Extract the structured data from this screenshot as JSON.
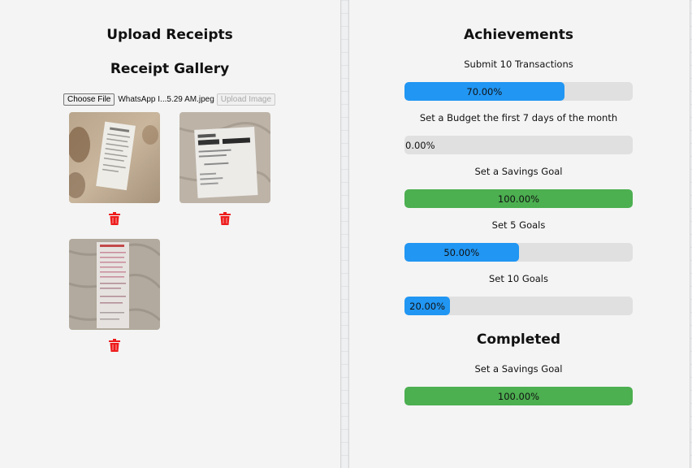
{
  "upload": {
    "title": "Upload Receipts",
    "gallery_title": "Receipt Gallery",
    "choose_file_label": "Choose File",
    "file_name": "WhatsApp I...5.29 AM.jpeg",
    "upload_button_label": "Upload Image",
    "receipts": [
      {
        "icon": "trash-icon"
      },
      {
        "icon": "trash-icon"
      },
      {
        "icon": "trash-icon"
      }
    ]
  },
  "achievements": {
    "title": "Achievements",
    "items": [
      {
        "label": "Submit 10 Transactions",
        "progress": 0.7,
        "progress_text": "70.00%",
        "color": "#2196f3"
      },
      {
        "label": "Set a Budget the first 7 days of the month",
        "progress": 0.0,
        "progress_text": "0.00%",
        "color": "#2196f3"
      },
      {
        "label": "Set a Savings Goal",
        "progress": 1.0,
        "progress_text": "100.00%",
        "color": "#4caf50"
      },
      {
        "label": "Set 5 Goals",
        "progress": 0.5,
        "progress_text": "50.00%",
        "color": "#2196f3"
      },
      {
        "label": "Set 10 Goals",
        "progress": 0.2,
        "progress_text": "20.00%",
        "color": "#2196f3"
      }
    ]
  },
  "completed": {
    "title": "Completed",
    "items": [
      {
        "label": "Set a Savings Goal",
        "progress": 1.0,
        "progress_text": "100.00%",
        "color": "#4caf50"
      }
    ]
  },
  "colors": {
    "progress_blue": "#2196f3",
    "progress_green": "#4caf50",
    "track": "#e0e0e0",
    "delete_red": "#ee1c1c"
  }
}
